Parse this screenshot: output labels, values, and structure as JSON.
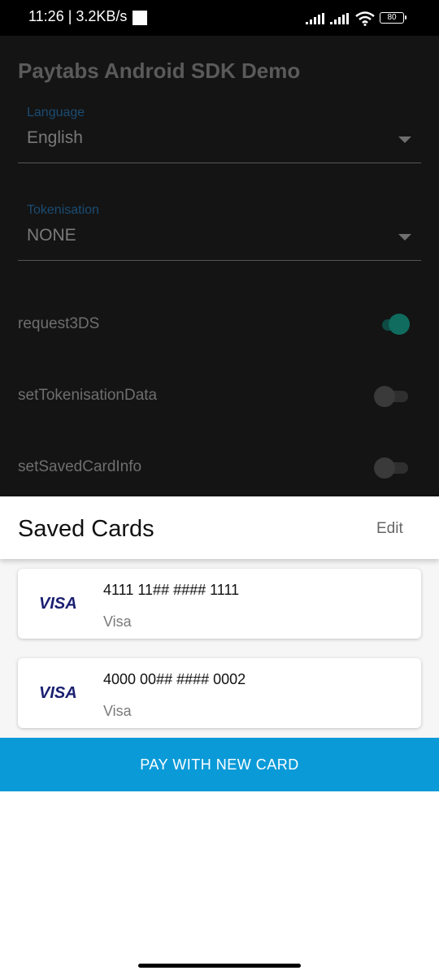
{
  "status_bar": {
    "time_speed": "11:26 | 3.2KB/s",
    "battery": "80",
    "icons": [
      "signal-icon",
      "signal-icon",
      "wifi-icon",
      "battery-icon"
    ]
  },
  "app": {
    "title": "Paytabs Android SDK Demo",
    "language": {
      "label": "Language",
      "value": "English"
    },
    "tokenisation": {
      "label": "Tokenisation",
      "value": "NONE"
    },
    "options": [
      {
        "label": "request3DS",
        "enabled": true
      },
      {
        "label": "setTokenisationData",
        "enabled": false
      },
      {
        "label": "setSavedCardInfo",
        "enabled": false
      }
    ],
    "colors": {
      "accent": "#0f6c5f",
      "label_blue": "#1b4c72",
      "background": "#141414"
    }
  },
  "sheet": {
    "title": "Saved Cards",
    "edit_label": "Edit",
    "cards": [
      {
        "brand": "VISA",
        "number": "4111 11## #### 1111",
        "type": "Visa"
      },
      {
        "brand": "VISA",
        "number": "4000 00## #### 0002",
        "type": "Visa"
      }
    ],
    "pay_button": "PAY WITH NEW CARD",
    "colors": {
      "button": "#0a9ad8",
      "visa_blue": "#1a1f71"
    }
  }
}
